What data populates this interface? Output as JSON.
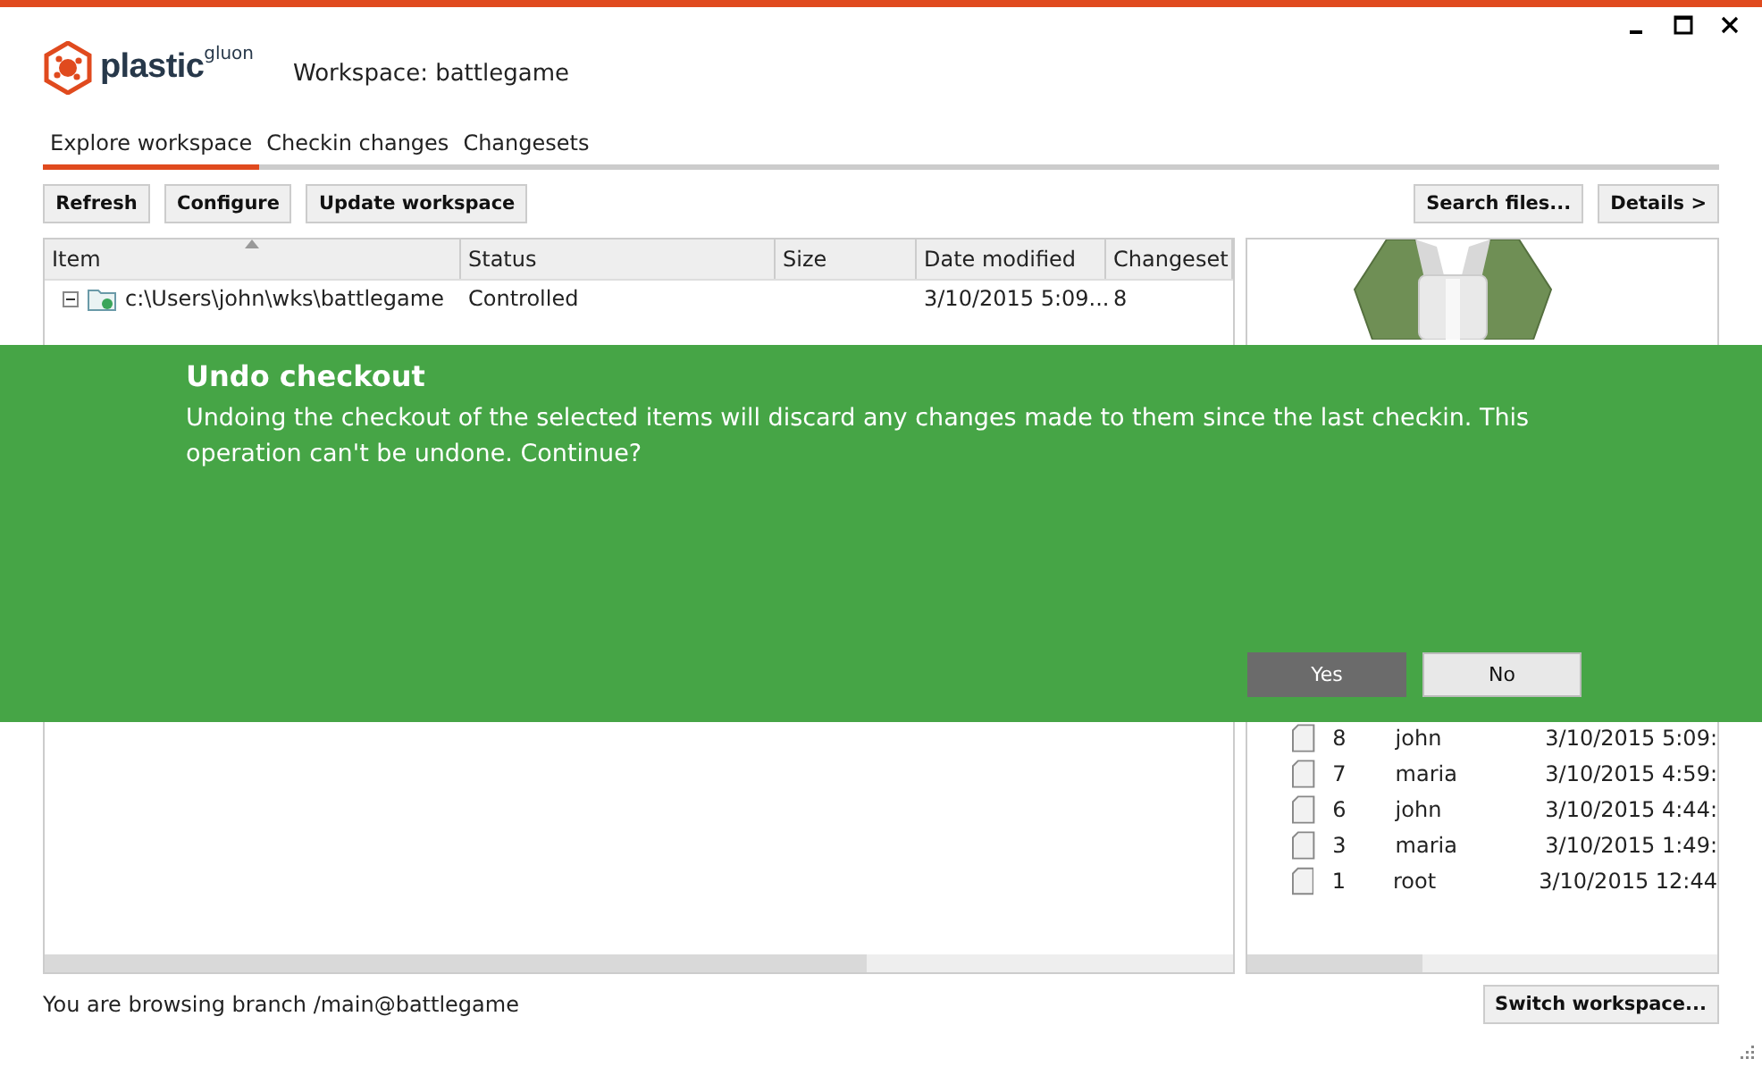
{
  "logo": {
    "name": "plastic",
    "suffix": "gluon"
  },
  "window": {
    "title": "Workspace: battlegame"
  },
  "tabs": [
    {
      "label": "Explore workspace",
      "selected": true
    },
    {
      "label": "Checkin changes",
      "selected": false
    },
    {
      "label": "Changesets",
      "selected": false
    }
  ],
  "toolbar": {
    "left_buttons": [
      "Refresh",
      "Configure",
      "Update workspace"
    ],
    "right_buttons": [
      "Search files...",
      "Details >"
    ]
  },
  "table": {
    "columns": [
      {
        "label": "Item",
        "sorted": true
      },
      {
        "label": "Status",
        "sorted": false
      },
      {
        "label": "Size",
        "sorted": false
      },
      {
        "label": "Date modified",
        "sorted": false
      },
      {
        "label": "Changeset",
        "sorted": false
      }
    ],
    "rows": [
      {
        "item": "c:\\Users\\john\\wks\\battlegame",
        "expanded": true,
        "status": "Controlled",
        "date_modified": "3/10/2015 5:09...",
        "changeset": "8"
      }
    ]
  },
  "history": {
    "rows": [
      {
        "changeset": "8",
        "user": "john",
        "date": "3/10/2015 5:09:"
      },
      {
        "changeset": "7",
        "user": "maria",
        "date": "3/10/2015 4:59:"
      },
      {
        "changeset": "6",
        "user": "john",
        "date": "3/10/2015 4:44:"
      },
      {
        "changeset": "3",
        "user": "maria",
        "date": "3/10/2015 1:49:"
      },
      {
        "changeset": "1",
        "user": "root",
        "date": "3/10/2015 12:44"
      }
    ]
  },
  "status_bar": {
    "text": "You are browsing branch /main@battlegame",
    "button": "Switch workspace..."
  },
  "dialog": {
    "title": "Undo checkout",
    "message": "Undoing the checkout of the selected items will discard any changes made to them since the last checkin. This operation can't be undone. Continue?",
    "buttons": [
      {
        "label": "Yes",
        "selected": true
      },
      {
        "label": "No",
        "selected": false
      }
    ]
  }
}
